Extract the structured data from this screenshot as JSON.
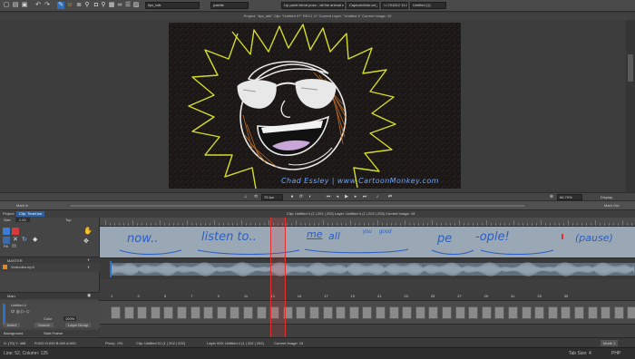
{
  "toolbar": {
    "scene_field": "lips_talk",
    "zoom_field": "palette",
    "layer_field": "Lip paint blend pose - all the animal chars",
    "cel_field": "CapturedInfo.cel_01",
    "frame_field": "<<701612 11:24",
    "view_field": "Untitled (1)"
  },
  "infobar": {
    "text": "Project: \"lips_talk\"   Clip: \"Untitled 07\"   REC1 1/\"   Current Layer: \"Untitled 4\"   Current Image: 15"
  },
  "artwork": {
    "caption": "Chad Essley | www.CartoonMonkey.com"
  },
  "viewbar": {
    "left_label": "Mark in",
    "fps_label": "75 fps",
    "zoom_value": "66.79%",
    "display_label": "Display",
    "markout_label": "Mark Out"
  },
  "project_row": {
    "project_label": "Project",
    "clip_label": "Clip: TimeLine",
    "center_text": "Clip: Untitled 4 (1 | 201 | 202)     Layer: Untitled 4 (1 | 202 | 203)     Current Image: 15"
  },
  "left_panel": {
    "size_label": "Size",
    "size_value": "1.00",
    "top_label": "Top",
    "fill_label": "Fill",
    "track_master": "MASTER",
    "track_audio": "Vorbodes.mp3",
    "layer_label": "Main",
    "layer_sub": "Untitled 4",
    "color_label": "Color",
    "opacity_value": "100%",
    "btn_insert": "Insert",
    "btn_source": "Source",
    "btn_layer_group": "Layer Group",
    "background_label": "Background",
    "bg_value": "Start Frame"
  },
  "lipsync_words": [
    "now..",
    "listen to..",
    "me",
    "all",
    "you",
    "good",
    "pe",
    "-ople!",
    "(pause)"
  ],
  "frame_numbers": [
    "1",
    "3",
    "5",
    "7",
    "9",
    "11",
    "13",
    "15",
    "17",
    "19",
    "21",
    "23",
    "25",
    "27",
    "29",
    "31",
    "33",
    "35"
  ],
  "status1": {
    "coords": "X: (70)  Y: 468",
    "rgb": "R:000 G:000 B:000 A:000",
    "proxy": "Proxy : 0%",
    "clip": "Clip: Untitled 01 (1 | 202 | 202)",
    "layer": "Layer 000: Untitled 4 (1 | 202 | 202)",
    "current": "Current Image: 15",
    "mode": "Mode 1"
  },
  "status2": {
    "position": "Line: 52, Column: 125",
    "tab_size": "Tab Size: 4",
    "language": "PHP"
  },
  "colors": {
    "sun_yellow": "#d4dc2a",
    "sun_orange": "#c9742a",
    "caption_blue": "#6aa6ff",
    "lipsync_ink": "#2b5fc4",
    "playhead": "#e03030"
  }
}
